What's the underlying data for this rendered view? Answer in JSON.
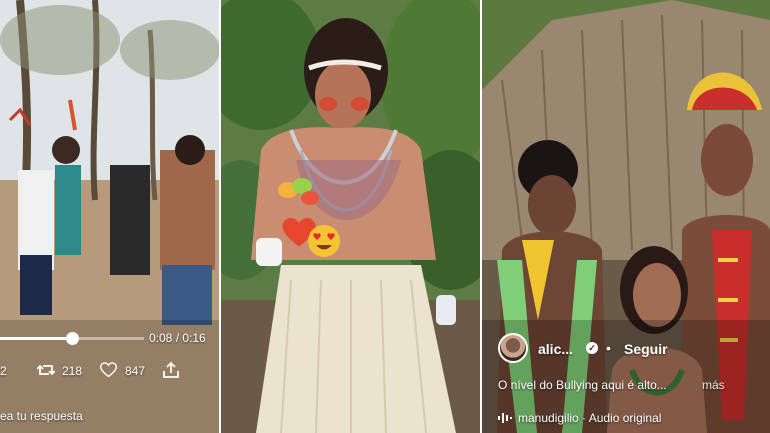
{
  "panel_left": {
    "video": {
      "time_label": "0:08 / 0:16",
      "progress": 0.5
    },
    "actions": {
      "comments_count": "2",
      "retweets_count": "218",
      "likes_count": "847",
      "retweet_icon": "retweet-icon",
      "like_icon": "heart-icon",
      "share_icon": "share-icon"
    },
    "reply_placeholder": "ea tu respuesta"
  },
  "panel_middle": {
    "stickers": [
      "heart-emoji-sticker",
      "heart-eyes-emoji-sticker"
    ]
  },
  "panel_right": {
    "username": "alic...",
    "follow_label": "Seguir",
    "caption": "O nível do Bullying aqui é alto...",
    "more_label": "más",
    "audio_label": "manudigilio · Audio original",
    "audio_icon": "audio-wave-icon"
  }
}
